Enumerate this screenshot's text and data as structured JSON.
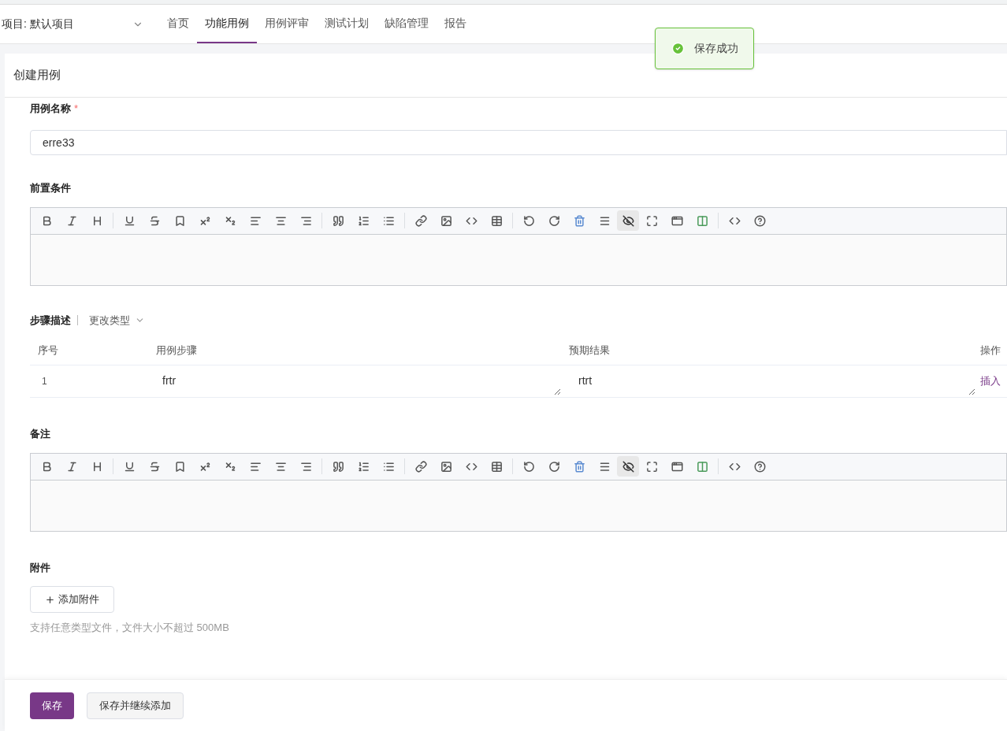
{
  "project_selector": {
    "value": "项目: 默认项目"
  },
  "nav": [
    {
      "label": "首页",
      "selected": false
    },
    {
      "label": "功能用例",
      "selected": true
    },
    {
      "label": "用例评审",
      "selected": false
    },
    {
      "label": "测试计划",
      "selected": false
    },
    {
      "label": "缺陷管理",
      "selected": false
    },
    {
      "label": "报告",
      "selected": false
    }
  ],
  "toast": {
    "message": "保存成功"
  },
  "page_title": "创建用例",
  "case_name": {
    "label": "用例名称",
    "required_mark": "*",
    "value": "erre33"
  },
  "precondition": {
    "label": "前置条件",
    "preview_on": true
  },
  "steps": {
    "label": "步骤描述",
    "change_type": "更改类型",
    "columns": [
      "序号",
      "用例步骤",
      "预期结果",
      "操作"
    ],
    "rows": [
      {
        "index": "1",
        "step": "frtr",
        "expected": "rtrt",
        "action": "插入"
      }
    ]
  },
  "remark": {
    "label": "备注",
    "preview_on": true
  },
  "attachment": {
    "label": "附件",
    "button": "添加附件",
    "hint": "支持任意类型文件，文件大小不超过 500MB"
  },
  "footer_buttons": [
    {
      "label": "保存",
      "kind": "primary"
    },
    {
      "label": "保存并继续添加",
      "kind": "secondary"
    }
  ]
}
